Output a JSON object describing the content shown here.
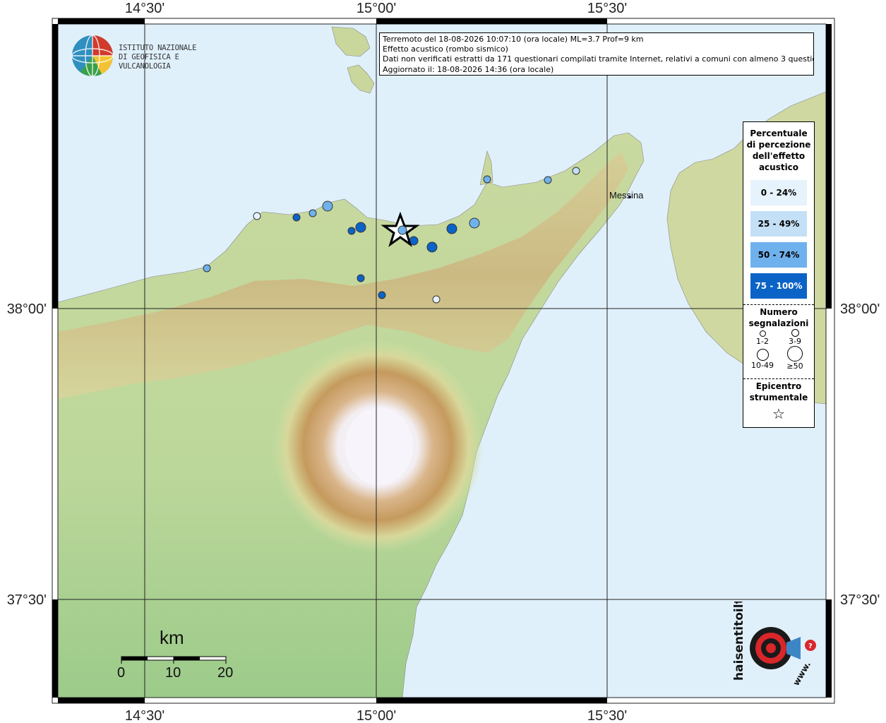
{
  "map": {
    "lon_labels": [
      "14°30'",
      "15°00'",
      "15°30'"
    ],
    "lat_labels": [
      "38°00'",
      "37°30'"
    ],
    "city": "Messina",
    "sea_color": "#e0f0fb"
  },
  "info": {
    "line1": "Terremoto del 18-08-2026 10:07:10 (ora locale) ML=3.7 Prof=9 km",
    "line2": "Effetto acustico (rombo sismico)",
    "line3": "Dati non verificati estratti da 171 questionari compilati tramite Internet, relativi a comuni con almeno 3 questionari.",
    "line4": "Aggiornato il: 18-08-2026 14:36 (ora locale)"
  },
  "logo": {
    "line1": "ISTITUTO NAZIONALE",
    "line2": "DI GEOFISICA E VULCANOLOGIA"
  },
  "legend": {
    "title_percent": [
      "Percentuale",
      "di percezione",
      "dell'effetto",
      "acustico"
    ],
    "classes": [
      {
        "label": "0 - 24%",
        "color": "#e6f3fd"
      },
      {
        "label": "25 - 49%",
        "color": "#c4e0f6"
      },
      {
        "label": "50 - 74%",
        "color": "#6fb1ec"
      },
      {
        "label": "75 - 100%",
        "color": "#0b63c7"
      }
    ],
    "title_count": [
      "Numero",
      "segnalazioni"
    ],
    "counts": [
      "1-2",
      "3-9",
      "10-49",
      "≥50"
    ],
    "title_epicenter": [
      "Epicentro",
      "strumentale"
    ]
  },
  "scale": {
    "unit": "km",
    "ticks": [
      "0",
      "10",
      "20"
    ]
  },
  "site": {
    "brand": "haisentitoilterremoto.it",
    "url": "www."
  }
}
